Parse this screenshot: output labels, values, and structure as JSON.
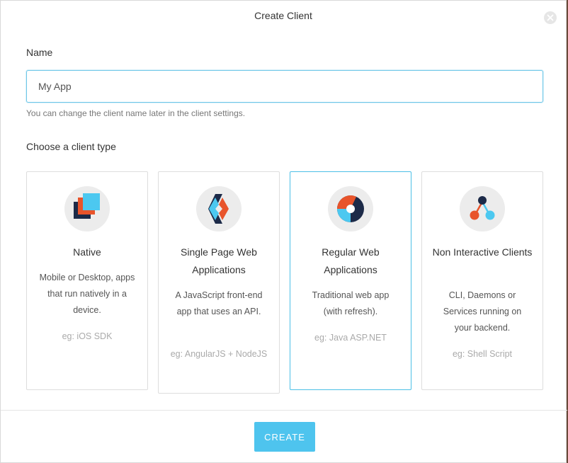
{
  "modal": {
    "title": "Create Client",
    "close_icon": "close-icon"
  },
  "name_field": {
    "label": "Name",
    "value": "My App",
    "help_text": "You can change the client name later in the client settings."
  },
  "client_type": {
    "label": "Choose a client type",
    "selected": "Regular Web Applications",
    "options": [
      {
        "title": "Native",
        "description": "Mobile or Desktop, apps that run natively in a device.",
        "example": "eg: iOS SDK",
        "icon": "native-app-icon"
      },
      {
        "title": "Single Page Web Applications",
        "description": "A JavaScript front-end app that uses an API.",
        "example": "eg: AngularJS + NodeJS",
        "icon": "spa-icon"
      },
      {
        "title": "Regular Web Applications",
        "description": "Traditional web app (with refresh).",
        "example": "eg: Java ASP.NET",
        "icon": "web-app-icon"
      },
      {
        "title": "Non Interactive Clients",
        "description": "CLI, Daemons or Services running on your backend.",
        "example": "eg: Shell Script",
        "icon": "non-interactive-icon"
      }
    ]
  },
  "footer": {
    "create_label": "CREATE"
  },
  "colors": {
    "accent": "#4ec4ee",
    "selected_border": "#4bbfe6",
    "navy": "#1c2a48",
    "orange": "#e8542b",
    "cyan": "#4cc8f0"
  }
}
